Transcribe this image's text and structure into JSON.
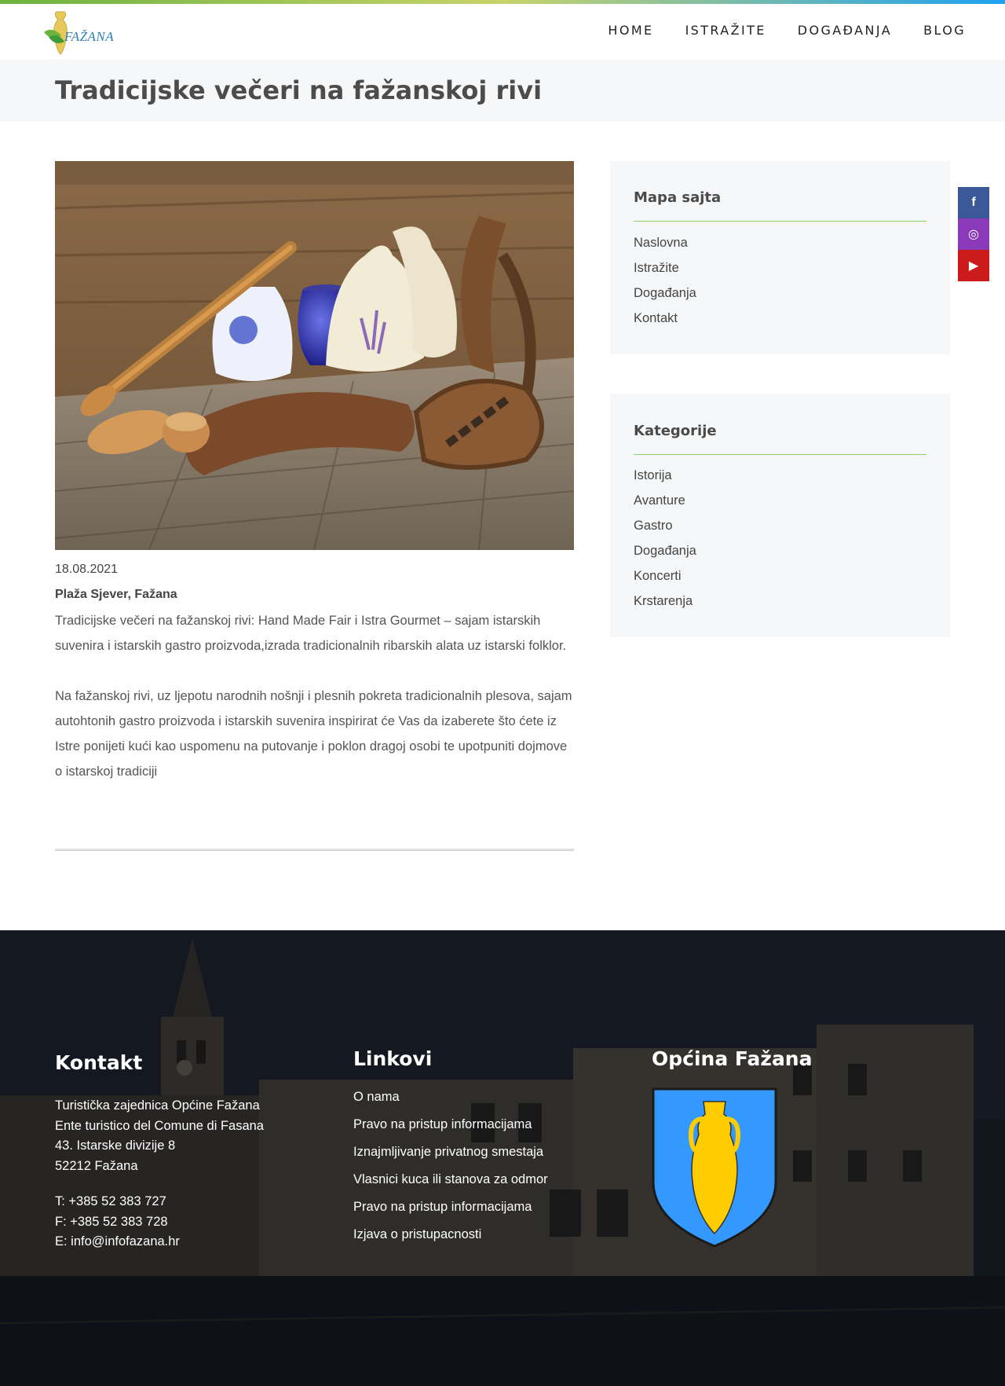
{
  "header": {
    "logo_text": "FAŽANA",
    "nav": [
      "HOME",
      "ISTRAŽITE",
      "DOGAĐANJA",
      "BLOG"
    ]
  },
  "page": {
    "title": "Tradicijske večeri na fažanskoj rivi"
  },
  "post": {
    "date": "18.08.2021",
    "location": "Plaža Sjever, Fažana",
    "paragraphs": [
      "Tradicijske večeri na fažanskoj rivi: Hand Made Fair i Istra Gourmet – sajam istarskih suvenira i istarskih gastro proizvoda,izrada tradicionalnih ribarskih alata uz istarski folklor.",
      "Na fažanskoj rivi, uz ljepotu narodnih nošnji i plesnih pokreta tradicionalnih plesova, sajam autohtonih gastro proizvoda i istarskih suvenira inspirirat će Vas da izaberete što ćete iz Istre ponijeti kući kao uspomenu na putovanje i poklon dragoj osobi te upotpuniti dojmove o istarskoj tradiciji"
    ]
  },
  "sidebar": {
    "sitemap": {
      "title": "Mapa sajta",
      "items": [
        "Naslovna",
        "Istražite",
        "Događanja",
        "Kontakt"
      ]
    },
    "categories": {
      "title": "Kategorije",
      "items": [
        "Istorija",
        "Avanture",
        "Gastro",
        "Događanja",
        "Koncerti",
        "Krstarenja"
      ]
    }
  },
  "social": {
    "facebook": "f",
    "instagram": "◎",
    "youtube": "▶"
  },
  "footer": {
    "contact": {
      "title": "Kontakt",
      "address": [
        "Turistička zajednica Općine Fažana",
        "Ente turistico del Comune di Fasana",
        "43. Istarske divizije 8",
        "52212 Fažana"
      ],
      "phone": "T: +385 52 383 727",
      "fax": "F: +385 52 383 728",
      "email": "E: info@infofazana.hr"
    },
    "links": {
      "title": "Linkovi",
      "items": [
        "O nama",
        "Pravo na pristup informacijama",
        "Iznajmljivanje privatnog smestaja",
        "Vlasnici kuca ili stanova za odmor",
        "Pravo na pristup informacijama",
        "Izjava o pristupacnosti"
      ]
    },
    "municipality": {
      "title": "Općina Fažana"
    }
  },
  "colors": {
    "accent_green": "#8ccf6b",
    "facebook": "#3b5998",
    "instagram": "#8a3ab9",
    "youtube": "#cc1b1b",
    "crest_blue": "#3399ff",
    "crest_gold": "#ffcc00"
  }
}
